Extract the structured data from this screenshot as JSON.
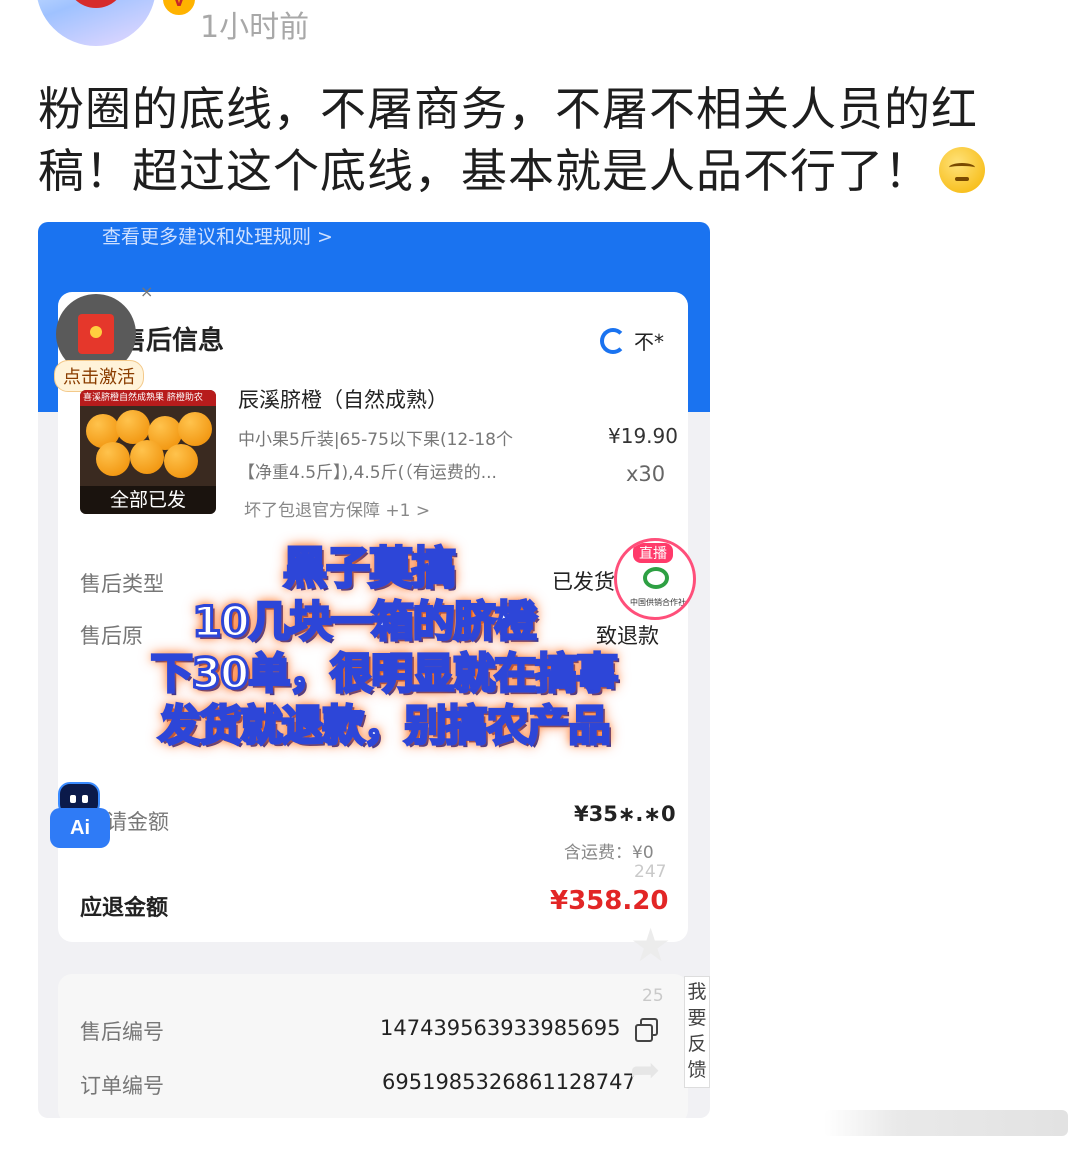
{
  "post": {
    "time": "1小时前",
    "text_line1": "粉圈的底线，不屠商务，不屠不相关人员的红",
    "text_line2": "稿！超过这个底线，基本就是人品不行了！",
    "emoji": "rolling-eyes-face-icon",
    "verified_badge": "V"
  },
  "screenshot": {
    "top_link": "查看更多建议和处理规则 >",
    "section_title": "售后信息",
    "close": "×",
    "red_packet_label": "点击激活",
    "buyer_name": "不*",
    "product": {
      "image_banner": "喜溪脐橙自然成熟果 脐橙助农",
      "image_caption": "全部已发",
      "name": "辰溪脐橙（自然成熟）",
      "spec_line1": "中小果5斤装|65-75以下果(12-18个",
      "spec_line2": "【净重4.5斤】),4.5斤(（有运费的...",
      "price": "¥19.90",
      "quantity": "x30",
      "guarantee": "坏了包退官方保障  +1  >"
    },
    "rows": {
      "type_label": "售后类型",
      "type_value": "已发货",
      "reason_label": "售后原",
      "reason_value": "致退款",
      "apply_amount_label": "请金额",
      "apply_amount_value": "¥35∗.∗0",
      "shipping_fee": "含运费：¥0",
      "refund_label": "应退金额",
      "refund_value": "¥358.20",
      "aftersale_id_label": "售后编号",
      "aftersale_id_value": "147439563933985695",
      "order_id_label": "订单编号",
      "order_id_value": "6951985326861128747"
    },
    "live_badge": {
      "tag": "直播",
      "org": "中国供销合作社"
    },
    "overlay": {
      "line1": "黑子莫搞",
      "line2": "10几块一箱的脐橙",
      "line3": "下30单，很明显就在搞事",
      "line4": "发货就退款，别搞农产品"
    },
    "ai_label": "Ai",
    "side_counts": {
      "likes": "247",
      "shares": "25"
    },
    "feedback": "我要反馈",
    "colors": {
      "brand_blue": "#1a73f0",
      "refund_red": "#e22626"
    }
  }
}
